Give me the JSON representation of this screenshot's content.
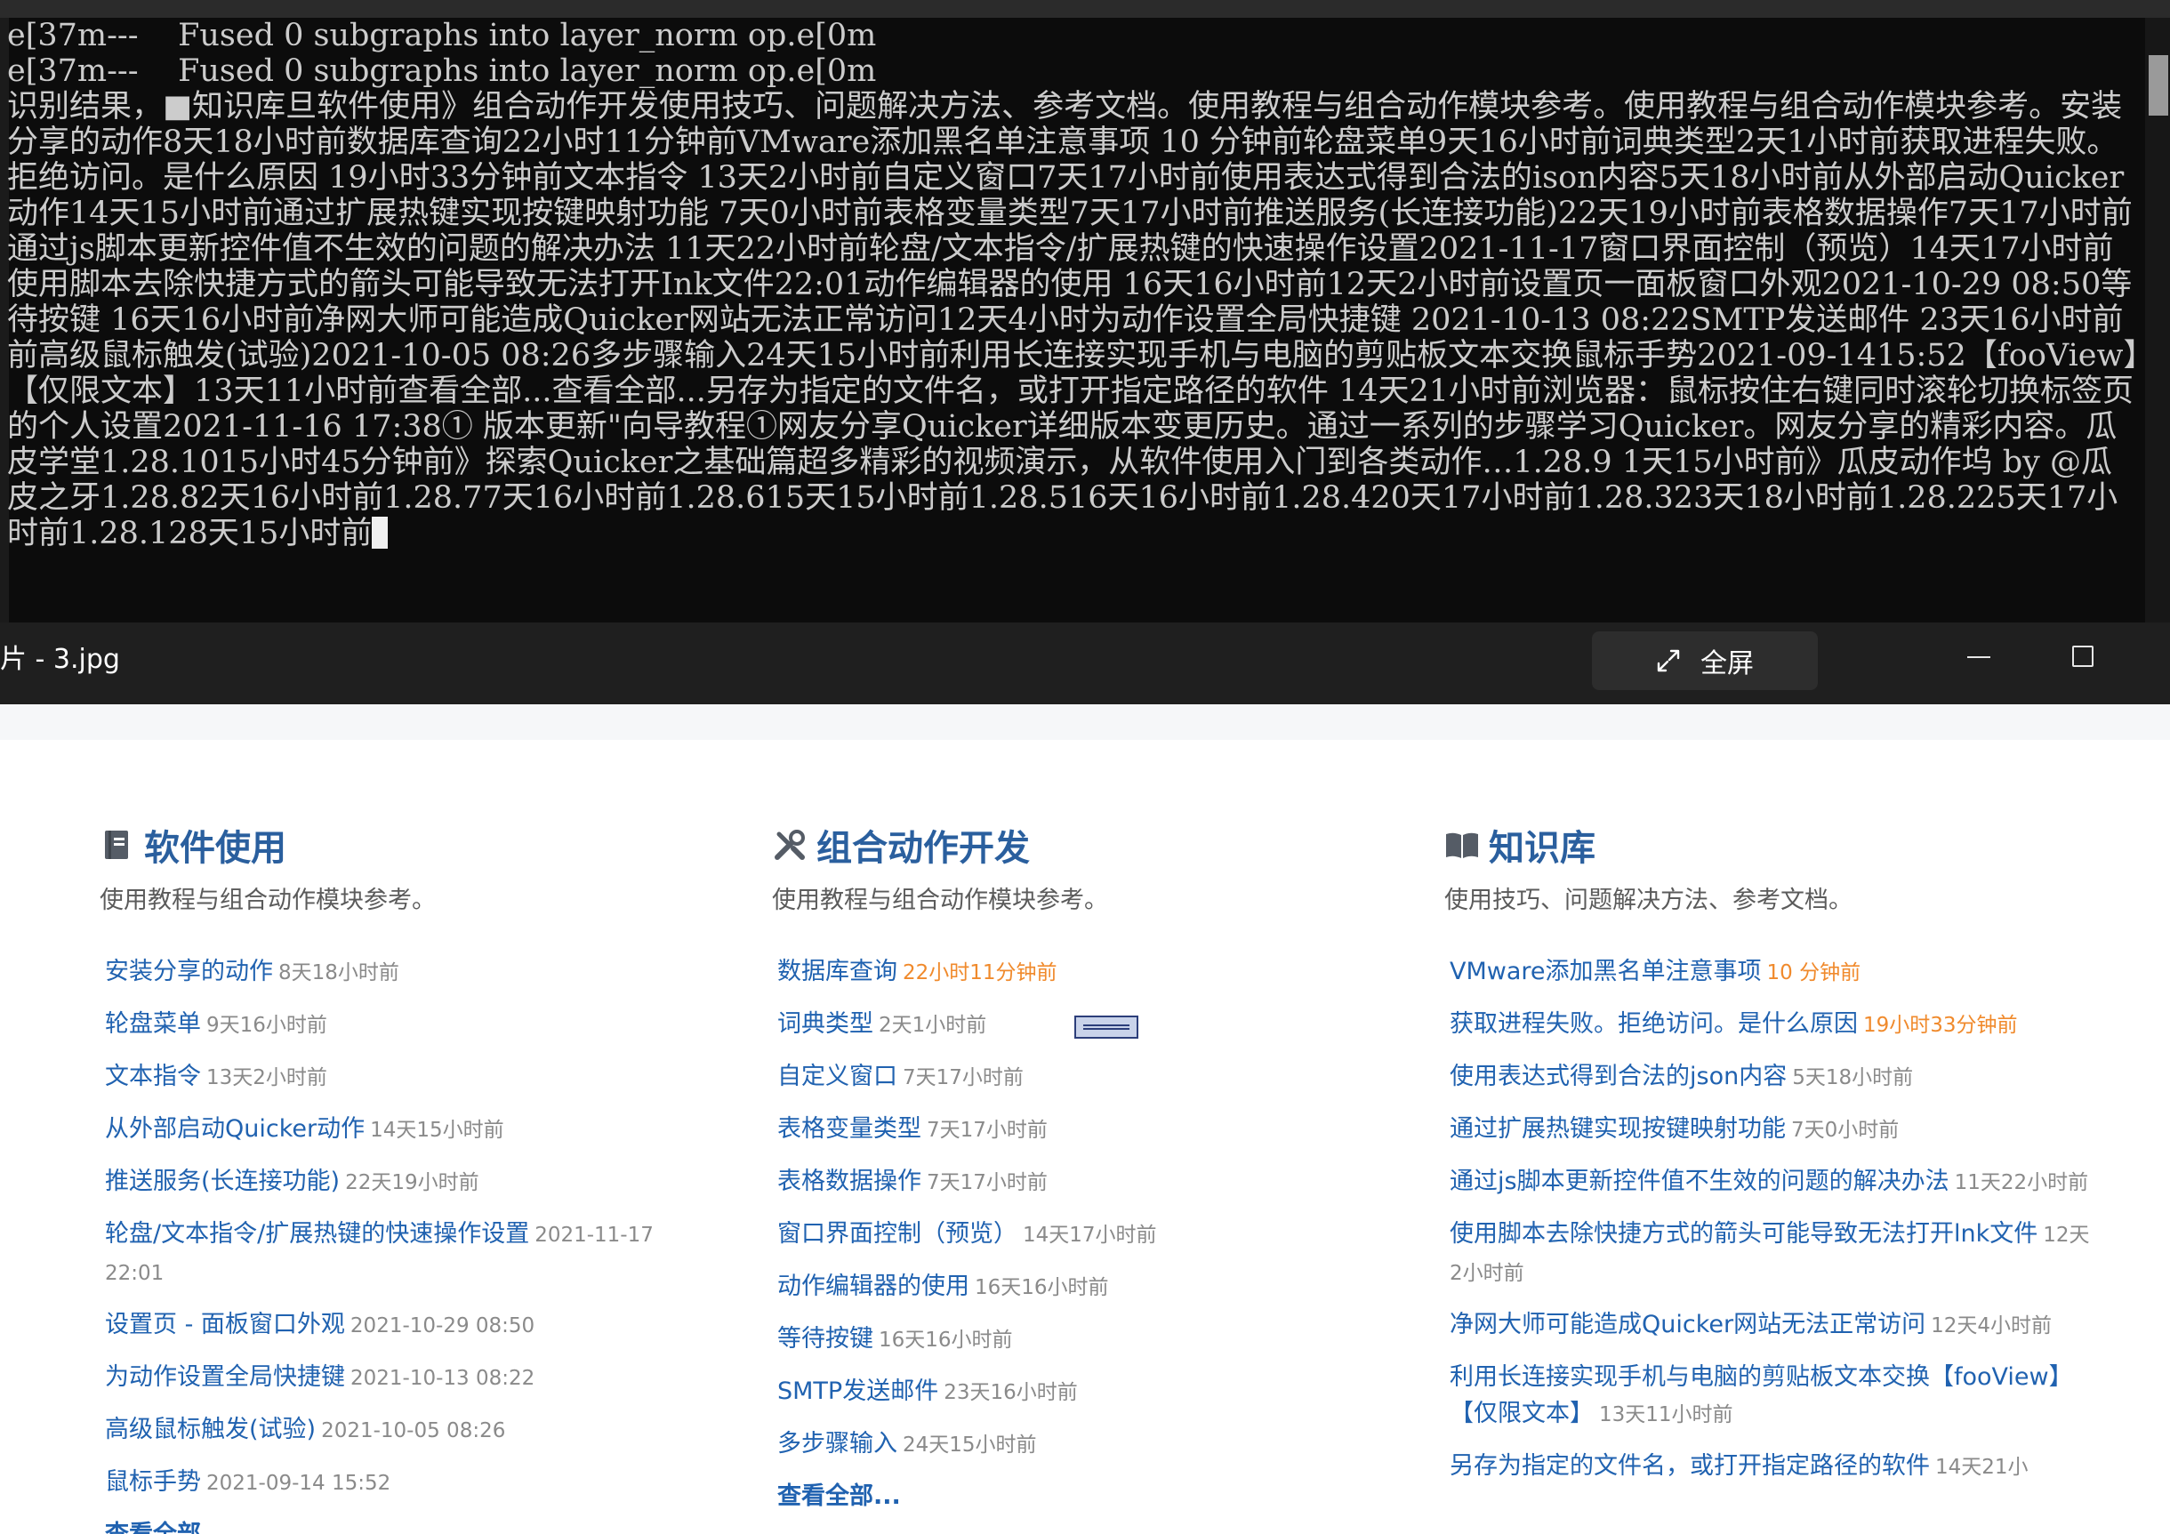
{
  "terminal": {
    "lines": [
      "e[37m---    Fused 0 subgraphs into layer_norm op.e[0m",
      "e[37m---    Fused 0 subgraphs into layer_norm op.e[0m"
    ],
    "ocr_text": "识别结果，■知识库旦软件使用》组合动作开发使用技巧、问题解决方法、参考文档。使用教程与组合动作模块参考。使用教程与组合动作模块参考。安装分享的动作8天18小时前数据库查询22小时11分钟前VMware添加黑名单注意事项 10 分钟前轮盘菜单9天16小时前词典类型2天1小时前获取进程失败。拒绝访问。是什么原因 19小时33分钟前文本指令 13天2小时前自定义窗口7天17小时前使用表达式得到合法的ison内容5天18小时前从外部启动Quicker动作14天15小时前通过扩展热键实现按键映射功能 7天0小时前表格变量类型7天17小时前推送服务(长连接功能)22天19小时前表格数据操作7天17小时前通过js脚本更新控件值不生效的问题的解决办法 11天22小时前轮盘/文本指令/扩展热键的快速操作设置2021-11-17窗口界面控制（预览）14天17小时前使用脚本去除快捷方式的箭头可能导致无法打开Ink文件22:01动作编辑器的使用 16天16小时前12天2小时前设置页一面板窗口外观2021-10-29 08:50等待按键 16天16小时前净网大师可能造成Quicker网站无法正常访问12天4小时为动作设置全局快捷键 2021-10-13 08:22SMTP发送邮件 23天16小时前前高级鼠标触发(试验)2021-10-05 08:26多步骤输入24天15小时前利用长连接实现手机与电脑的剪贴板文本交换鼠标手势2021-09-1415:52【fooView】【仅限文本】13天11小时前查看全部...查看全部...另存为指定的文件名，或打开指定路径的软件 14天21小时前浏览器：鼠标按住右键同时滚轮切换标签页的个人设置2021-11-16 17:38① 版本更新\"向导教程①网友分享Quicker详细版本变更历史。通过一系列的步骤学习Quicker。网友分享的精彩内容。瓜皮学堂1.28.1015小时45分钟前》探索Quicker之基础篇超多精彩的视频演示，从软件使用入门到各类动作…1.28.9 1天15小时前》瓜皮动作坞 by @瓜皮之牙1.28.82天16小时前1.28.77天16小时前1.28.615天15小时前1.28.516天16小时前1.28.420天17小时前1.28.323天18小时前1.28.225天17小时前1.28.128天15小时前"
  },
  "viewer": {
    "title": "片 - 3.jpg",
    "fullscreen_label": "全屏",
    "fullscreen_icon": "expand-arrows-icon",
    "minimize_icon": "minimize-icon",
    "maximize_icon": "maximize-icon"
  },
  "columns": [
    {
      "icon": "book-icon",
      "title": "软件使用",
      "desc": "使用教程与组合动作模块参考。",
      "items": [
        {
          "title": "安装分享的动作",
          "time": "8天18小时前",
          "hot": false
        },
        {
          "title": "轮盘菜单",
          "time": "9天16小时前",
          "hot": false
        },
        {
          "title": "文本指令",
          "time": "13天2小时前",
          "hot": false
        },
        {
          "title": "从外部启动Quicker动作",
          "time": "14天15小时前",
          "hot": false
        },
        {
          "title": "推送服务(长连接功能)",
          "time": "22天19小时前",
          "hot": false
        },
        {
          "title": "轮盘/文本指令/扩展热键的快速操作设置",
          "time": "2021-11-17 22:01",
          "hot": false
        },
        {
          "title": "设置页 - 面板窗口外观",
          "time": "2021-10-29 08:50",
          "hot": false
        },
        {
          "title": "为动作设置全局快捷键",
          "time": "2021-10-13 08:22",
          "hot": false
        },
        {
          "title": "高级鼠标触发(试验)",
          "time": "2021-10-05 08:26",
          "hot": false
        },
        {
          "title": "鼠标手势",
          "time": "2021-09-14 15:52",
          "hot": false
        }
      ],
      "more": "查看全部"
    },
    {
      "icon": "tools-icon",
      "title": "组合动作开发",
      "desc": "使用教程与组合动作模块参考。",
      "items": [
        {
          "title": "数据库查询",
          "time": "22小时11分钟前",
          "hot": true
        },
        {
          "title": "词典类型",
          "time": "2天1小时前",
          "hot": false
        },
        {
          "title": "自定义窗口",
          "time": "7天17小时前",
          "hot": false
        },
        {
          "title": "表格变量类型",
          "time": "7天17小时前",
          "hot": false
        },
        {
          "title": "表格数据操作",
          "time": "7天17小时前",
          "hot": false
        },
        {
          "title": "窗口界面控制（预览）",
          "time": "14天17小时前",
          "hot": false
        },
        {
          "title": "动作编辑器的使用",
          "time": "16天16小时前",
          "hot": false
        },
        {
          "title": "等待按键",
          "time": "16天16小时前",
          "hot": false
        },
        {
          "title": "SMTP发送邮件",
          "time": "23天16小时前",
          "hot": false
        },
        {
          "title": "多步骤输入",
          "time": "24天15小时前",
          "hot": false
        }
      ],
      "more": "查看全部..."
    },
    {
      "icon": "open-book-icon",
      "title": "知识库",
      "desc": "使用技巧、问题解决方法、参考文档。",
      "items": [
        {
          "title": "VMware添加黑名单注意事项",
          "time": "10 分钟前",
          "hot": true
        },
        {
          "title": "获取进程失败。拒绝访问。是什么原因",
          "time": "19小时33分钟前",
          "hot": true
        },
        {
          "title": "使用表达式得到合法的json内容",
          "time": "5天18小时前",
          "hot": false
        },
        {
          "title": "通过扩展热键实现按键映射功能",
          "time": "7天0小时前",
          "hot": false
        },
        {
          "title": "通过js脚本更新控件值不生效的问题的解决办法",
          "time": "11天22小时前",
          "hot": false
        },
        {
          "title": "使用脚本去除快捷方式的箭头可能导致无法打开lnk文件",
          "time": "12天2小时前",
          "hot": false
        },
        {
          "title": "净网大师可能造成Quicker网站无法正常访问",
          "time": "12天4小时前",
          "hot": false
        },
        {
          "title": "利用长连接实现手机与电脑的剪贴板文本交换【fooView】【仅限文本】",
          "time": "13天11小时前",
          "hot": false
        },
        {
          "title": "另存为指定的文件名，或打开指定路径的软件",
          "time": "14天21小",
          "hot": false
        }
      ],
      "more": ""
    }
  ],
  "colors": {
    "heading": "#2a5f9e",
    "link": "#2062b0",
    "time": "#8a8a8a",
    "hot_time": "#f08a2c",
    "terminal_bg": "#0c0c0c",
    "terminal_text": "#cccccc"
  }
}
